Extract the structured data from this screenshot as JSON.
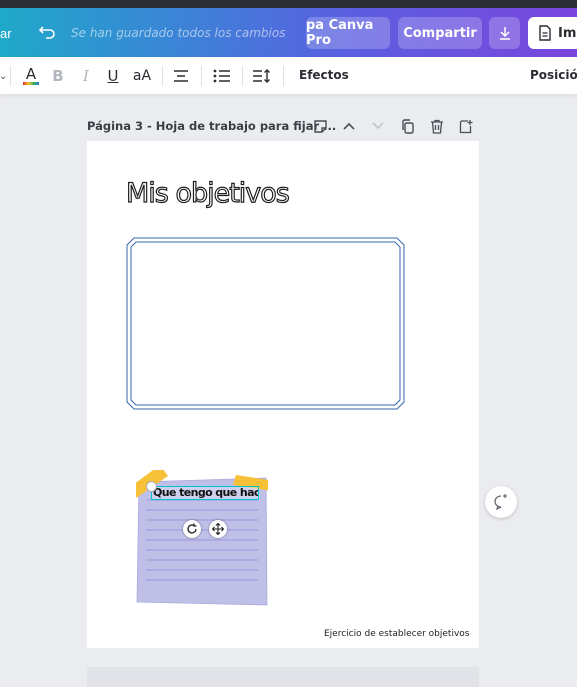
{
  "topbar": {
    "left_label": "ar",
    "saved_status": "Se han guardado todos los cambios",
    "pro_button": "pa Canva Pro",
    "share_button": "Compartir",
    "print_button": "Imp"
  },
  "toolbar": {
    "text_color_label": "A",
    "bold_label": "B",
    "italic_label": "I",
    "underline_label": "U",
    "case_label": "aA",
    "effects_label": "Efectos",
    "position_label": "Posición"
  },
  "page_header": {
    "label": "Página 3 - Hoja de trabajo para fijar ..."
  },
  "canvas": {
    "title": "Mis objetivos",
    "note_text": "Que tengo que hacer",
    "footer": "Ejercicio de establecer objetivos"
  },
  "colors": {
    "accent": "#00c4cc",
    "note": "#c6c6ea",
    "tape": "#f6c037"
  }
}
